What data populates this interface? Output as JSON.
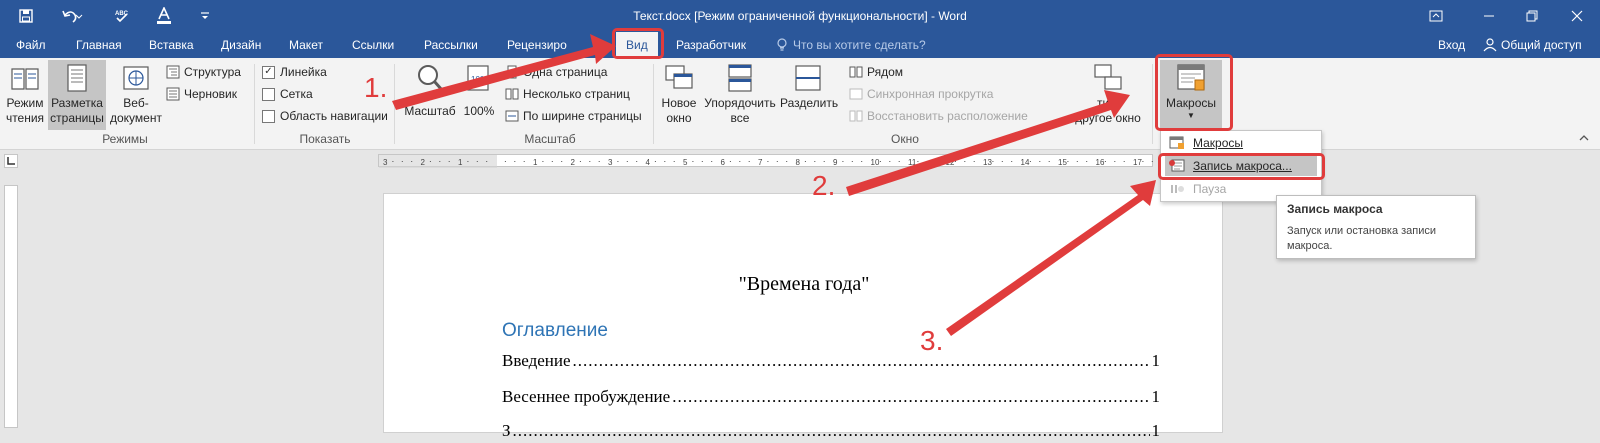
{
  "window": {
    "title": "Текст.docx [Режим ограниченной функциональности] - Word",
    "controls": [
      "ribbon-display-icon",
      "minimize-icon",
      "restore-icon",
      "close-icon"
    ]
  },
  "quick_access": {
    "icons": [
      "save-icon",
      "undo-icon",
      "spelling-icon",
      "font-color-icon",
      "customize-icon"
    ]
  },
  "tabs": [
    "Файл",
    "Главная",
    "Вставка",
    "Дизайн",
    "Макет",
    "Ссылки",
    "Рассылки",
    "Рецензиро",
    "Вид",
    "Разработчик"
  ],
  "active_tab": "Вид",
  "tell_me": "Что вы хотите сделать?",
  "account": {
    "login": "Вход",
    "share": "Общий доступ"
  },
  "ribbon": {
    "views": {
      "label": "Режимы",
      "read_mode": "Режим\nчтения",
      "print_layout": "Разметка\nстраницы",
      "web_layout": "Веб-\nдокумент",
      "outline": "Структура",
      "draft": "Черновик"
    },
    "show": {
      "label": "Показать",
      "ruler": "Линейка",
      "gridlines": "Сетка",
      "nav_pane": "Область навигации"
    },
    "zoom": {
      "label": "Масштаб",
      "zoom": "Масштаб",
      "hundred": "100%",
      "one_page": "Одна страница",
      "multiple_pages": "Несколько страниц",
      "page_width": "По ширине страницы"
    },
    "window_group": {
      "label": "Окно",
      "new_window": "Новое\nокно",
      "arrange_all": "Упорядочить\nвсе",
      "split": "Разделить",
      "side_by_side": "Рядом",
      "sync_scroll": "Синхронная прокрутка",
      "reset_position": "Восстановить расположение",
      "switch_windows": "ти в\nдругое окно"
    },
    "macros": {
      "label": "Макросы"
    }
  },
  "macros_menu": {
    "items": [
      "Макросы",
      "Запись макроса...",
      "Пауза"
    ]
  },
  "tooltip": {
    "title": "Запись макроса",
    "body": "Запуск или остановка записи макроса."
  },
  "document": {
    "title": "\"Времена года\"",
    "toc_heading": "Оглавление",
    "toc": [
      {
        "text": "Введение",
        "page": "1"
      },
      {
        "text": "Весеннее пробуждение",
        "page": "1"
      },
      {
        "text": "З",
        "page": "1"
      }
    ]
  },
  "annotations": {
    "step1": "1.",
    "step2": "2.",
    "step3": "3."
  },
  "colors": {
    "accent": "#2b579a",
    "highlight": "#e03c3c",
    "heading": "#2e74b5"
  }
}
